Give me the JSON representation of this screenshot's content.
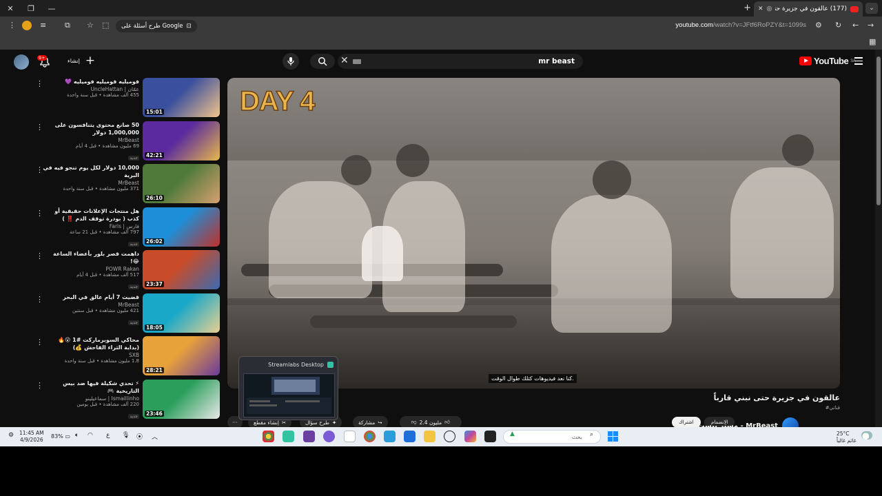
{
  "browser": {
    "tab_title": "(177) عالقون في جزيرة حتى...",
    "url_host": "youtube.com",
    "url_path": "/watch?v=JFtf6RoPZY&t=1099s",
    "google_pill": "طرح أسئلة على Google"
  },
  "header": {
    "search_query": "mr beast",
    "notification_count": "9+",
    "create_label": "إنشاء",
    "logo_text": "YouTube",
    "logo_region": "SA"
  },
  "player": {
    "overlay_title": "DAY 4",
    "subtitle": "كنا نعد فيديوهات كتلك طوال الوقت."
  },
  "video": {
    "title": "عالقون في جزيرة حتى نبني قارباً",
    "hashtag": "#قناتي",
    "channel_name": "MrBeast - مستر بيست",
    "join_label": "الانضمام",
    "subscribe_label": "اشتراك",
    "like_count": "2.4 مليون",
    "share_label": "مشاركة",
    "ask_label": "طرح سؤال",
    "clip_label": "إنشاء مقطع"
  },
  "popup": {
    "title": "Streamlabs Desktop"
  },
  "recommendations": [
    {
      "title": "فوميليه فوميليه فوميليه 💜",
      "channel": "عمّان | UncleHattan",
      "views": "455 ألف مشاهدة • قبل سنة واحدة",
      "duration": "15:01",
      "badge": "",
      "color1": "#3a4f9e",
      "color2": "#f2c48a"
    },
    {
      "title": "50 صانع محتوى يتنافسون على 1,000,000 دولار",
      "channel": "MrBeast",
      "views": "69 مليون مشاهدة • قبل 4 أيام",
      "duration": "42:21",
      "badge": "جديد",
      "color1": "#5a2a9e",
      "color2": "#e6b84a"
    },
    {
      "title": "10,000 دولار لكل يوم تنجو فيه في البرية",
      "channel": "MrBeast",
      "views": "371 مليون مشاهدة • قبل سنة واحدة",
      "duration": "26:10",
      "badge": "",
      "color1": "#4f7a3a",
      "color2": "#d8a070"
    },
    {
      "title": "هل منتجات الإعلانات حقيقية أو كذب ( بودرة توقف الدم ‼️ )",
      "channel": "فارس | Faris",
      "views": "797 ألف مشاهدة • قبل 21 ساعة",
      "duration": "26:02",
      "badge": "جديد",
      "color1": "#1d8fd8",
      "color2": "#c0302a"
    },
    {
      "title": "داهمت قصر بلور بأعضاء الساعة 😂!",
      "channel": "POWR Rakan",
      "views": "517 ألف مشاهدة • قبل 4 أيام",
      "duration": "23:37",
      "badge": "جديد",
      "color1": "#c94c2a",
      "color2": "#3a6ab0"
    },
    {
      "title": "قضيت 7 أيام عالق في البحر",
      "channel": "MrBeast",
      "views": "421 مليون مشاهدة • قبل سنتين",
      "duration": "18:05",
      "badge": "جديد",
      "color1": "#1aa8c8",
      "color2": "#e9d090"
    },
    {
      "title": "محاكي السوبرماركت #1 😮🔥 (بداية الثراء الفاحش 💰)",
      "channel": "SXB",
      "views": "1.8 مليون مشاهدة • قبل سنة واحدة",
      "duration": "28:21",
      "badge": "",
      "color1": "#e8a23a",
      "color2": "#6a3a9e"
    },
    {
      "title": "⚡ تحدي شكيلة فيها ضد بيس التاريخية 🎮",
      "channel": "Ismaillinho | سماعيلينو",
      "views": "220 ألف مشاهدة • قبل يومين",
      "duration": "23:46",
      "badge": "جديد",
      "color1": "#2a9e5a",
      "color2": "#e9e9e9"
    }
  ],
  "taskbar": {
    "time": "11:45 AM",
    "date": "4/9/2026",
    "battery": "83%",
    "lang": "ع",
    "search_placeholder": "بحث",
    "temp": "25°C",
    "weather_text": "غائم غالباً"
  }
}
